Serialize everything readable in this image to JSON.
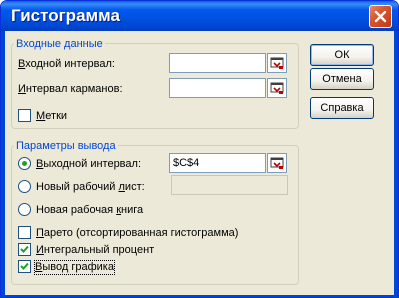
{
  "window": {
    "title": "Гистограмма"
  },
  "input_group": {
    "legend": "Входные данные",
    "input_range_label_pre": "",
    "input_range_label_u": "В",
    "input_range_label_post": "ходной интервал:",
    "input_range_value": "",
    "bin_range_label_pre": "",
    "bin_range_label_u": "И",
    "bin_range_label_post": "нтервал карманов:",
    "bin_range_value": "",
    "labels_label_pre": "",
    "labels_label_u": "М",
    "labels_label_post": "етки",
    "labels_checked": false
  },
  "output_group": {
    "legend": "Параметры вывода",
    "output_range_label_pre": "",
    "output_range_label_u": "В",
    "output_range_label_post": "ыходной интервал:",
    "output_range_value": "$C$4",
    "output_range_selected": true,
    "new_sheet_label_pre": "Новый рабочий ",
    "new_sheet_label_u": "л",
    "new_sheet_label_post": "ист:",
    "new_sheet_value": "",
    "new_book_label_pre": "Новая рабочая ",
    "new_book_label_u": "к",
    "new_book_label_post": "нига",
    "pareto_label_pre": "",
    "pareto_label_u": "П",
    "pareto_label_post": "арето (отсортированная гистограмма)",
    "pareto_checked": false,
    "cumulative_label_pre": "",
    "cumulative_label_u": "И",
    "cumulative_label_post": "нтегральный процент",
    "cumulative_checked": true,
    "chart_label_pre": "",
    "chart_label_u": "В",
    "chart_label_post": "ывод графика",
    "chart_checked": true
  },
  "buttons": {
    "ok": "ОК",
    "cancel": "Отмена",
    "help": "Справка"
  },
  "colors": {
    "legend": "#0046D5",
    "dialog_bg": "#ECE9D8",
    "titlebar": "#0058EE",
    "radio_dot": "#21A121",
    "check_mark": "#21A121"
  }
}
